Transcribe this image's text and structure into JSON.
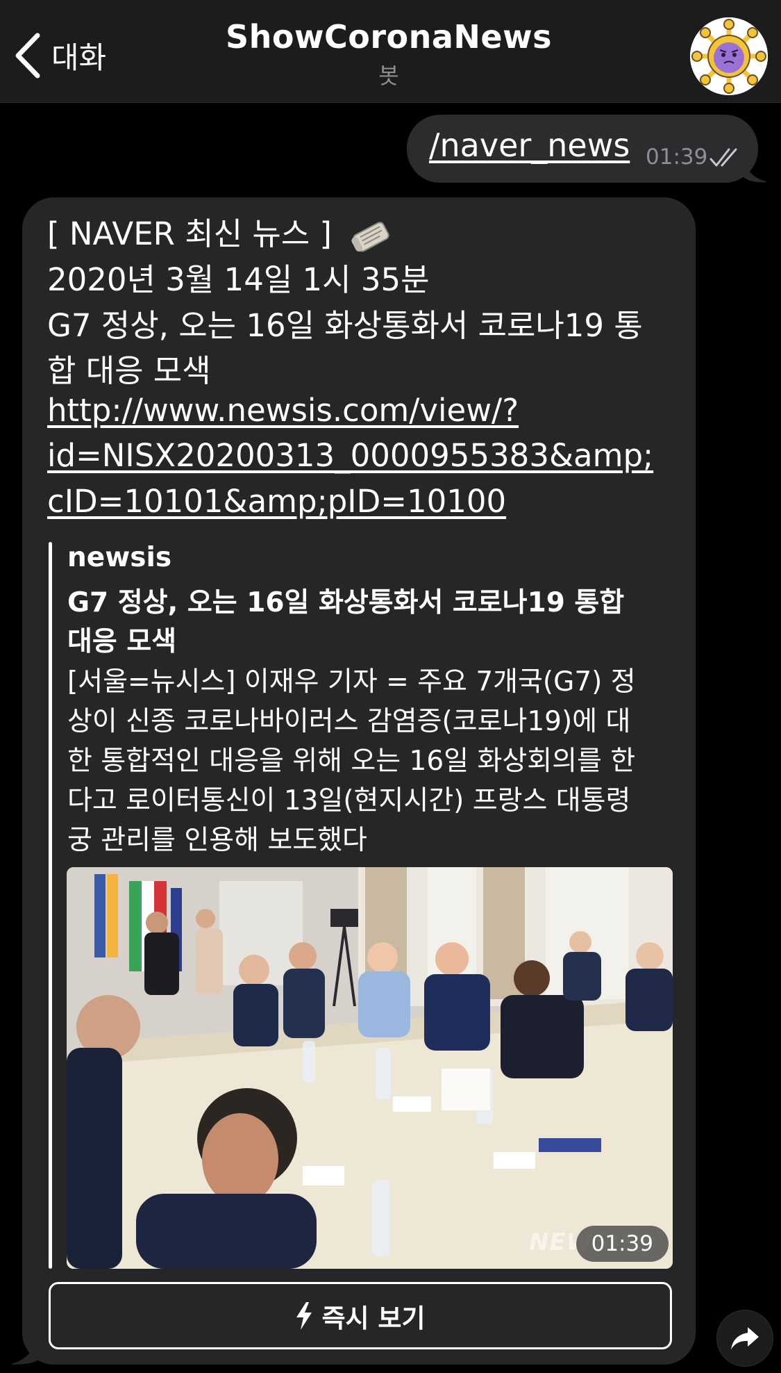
{
  "header": {
    "back_label": "대화",
    "title": "ShowCoronaNews",
    "subtitle": "봇",
    "avatar_icon": "virus-mascot-icon"
  },
  "outgoing": {
    "text": "/naver_news",
    "time": "01:39",
    "status_icon": "double-check-icon"
  },
  "incoming": {
    "header_line": "[ NAVER 최신 뉴스 ]",
    "header_icon": "newspaper-icon",
    "date_line": "2020년 3월 14일 1시 35분",
    "headline_lines": [
      "G7 정상, 오는 16일 화상통화서 코로나19 통",
      "합 대응 모색"
    ],
    "link_lines": [
      "http://www.newsis.com/view/?",
      "id=NISX20200313_0000955383&amp;",
      "cID=10101&amp;pID=10100"
    ],
    "preview": {
      "site": "newsis",
      "title_lines": [
        "G7 정상, 오는 16일 화상통화서 코로나19 통합",
        "대응 모색"
      ],
      "description_lines": [
        "[서울=뉴시스] 이재우 기자 = 주요 7개국(G7) 정",
        "상이 신종 코로나바이러스 감염증(코로나19)에 대",
        "한 통합적인 대응을 위해 오는 16일 화상회의를 한",
        "다고 로이터통신이 13일(현지시간) 프랑스 대통령",
        "궁 관리를 인용해 보도했다"
      ],
      "image_time": "01:39",
      "watermark": "NEWSIS"
    },
    "instant_view_label": "즉시 보기"
  },
  "colors": {
    "background": "#000000",
    "header_bg": "#1c1c1d",
    "bubble_bg": "#262628",
    "outgoing_bg": "#2c2c2e",
    "meta_text": "#8e8e93"
  }
}
